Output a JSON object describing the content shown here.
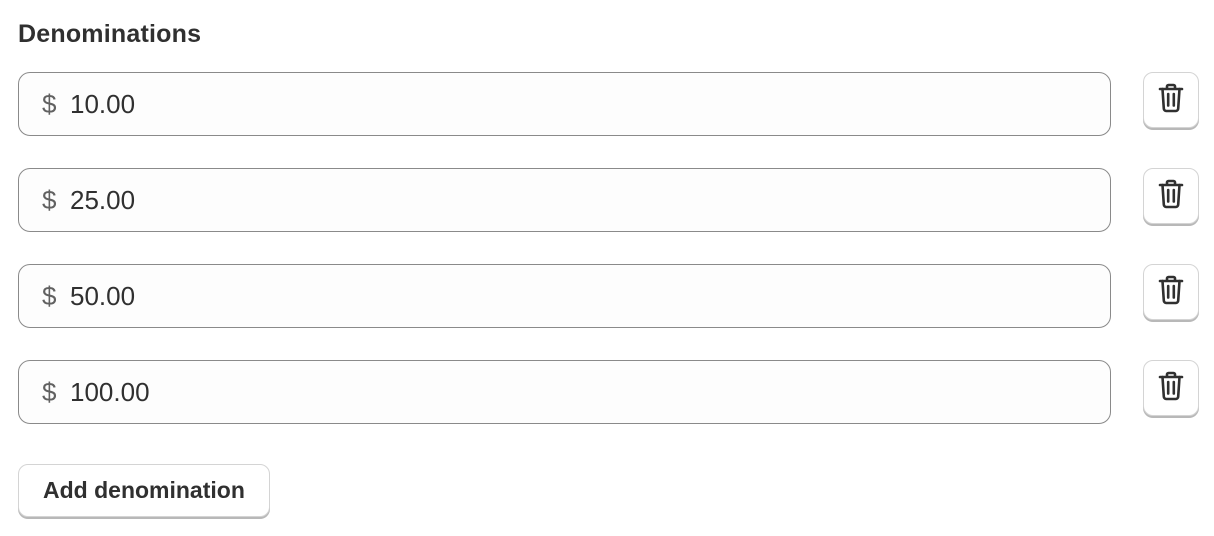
{
  "section": {
    "title": "Denominations"
  },
  "denominations": [
    {
      "prefix": "$",
      "value": "10.00",
      "delete_icon": "trash-icon"
    },
    {
      "prefix": "$",
      "value": "25.00",
      "delete_icon": "trash-icon"
    },
    {
      "prefix": "$",
      "value": "50.00",
      "delete_icon": "trash-icon"
    },
    {
      "prefix": "$",
      "value": "100.00",
      "delete_icon": "trash-icon"
    }
  ],
  "actions": {
    "add_label": "Add denomination"
  }
}
